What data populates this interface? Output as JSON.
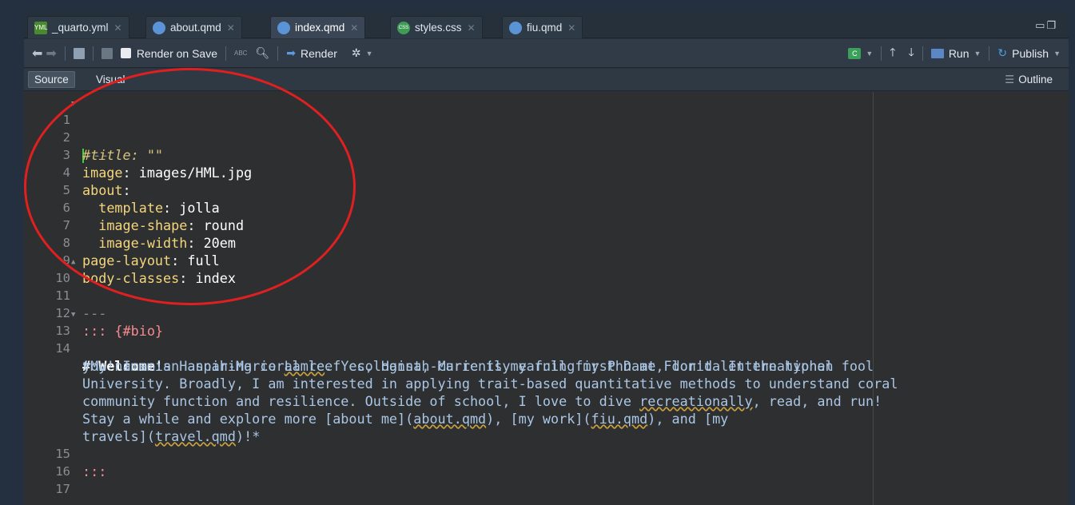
{
  "tabs": [
    {
      "label": "_quarto.yml",
      "icon": "yml-file-icon",
      "icon_text": "YML",
      "active": false
    },
    {
      "label": "about.qmd",
      "icon": "quarto-file-icon",
      "active": false
    },
    {
      "label": "index.qmd",
      "icon": "quarto-file-icon",
      "active": true
    },
    {
      "label": "styles.css",
      "icon": "css-file-icon",
      "icon_text": "CSS",
      "active": false
    },
    {
      "label": "fiu.qmd",
      "icon": "quarto-file-icon",
      "active": false
    }
  ],
  "toolbar": {
    "render_on_save": "Render on Save",
    "render": "Render",
    "run": "Run",
    "publish": "Publish",
    "insert_chunk_text": "C",
    "spell_abc": "ABC"
  },
  "modebar": {
    "source": "Source",
    "visual": "Visual",
    "outline": "Outline"
  },
  "editor": {
    "line_numbers": [
      "1",
      "2",
      "3",
      "4",
      "5",
      "6",
      "7",
      "8",
      "9",
      "10",
      "11",
      "12",
      "13",
      "14",
      "",
      "",
      "",
      "",
      "",
      "15",
      "16",
      "17"
    ],
    "l1": "---",
    "l2": "#title: \"\"",
    "l3_key": "image",
    "l3_val": "images/HML.jpg",
    "l4_key": "about",
    "l5_key": "template",
    "l5_val": "jolla",
    "l6_key": "image-shape",
    "l6_val": "round",
    "l7_key": "image-width",
    "l7_val": "20em",
    "l8_key": "page-layout",
    "l8_val": "full",
    "l9_key": "body-classes",
    "l9_val": "index",
    "l10": "---",
    "l12": "::: {#bio}",
    "l13": "# Welcome!",
    "l14_a1": "*My name is Hannah-Marie ",
    "l14_a2": "Lamle",
    "l14_a3": ". Yes, Hannah-Marie is my full first name, don't let the hyphen fool",
    "l14_b": "you! I am an aspiring coral reef ecologist, currently earning my PhD at Florida International",
    "l14_c": "University. Broadly, I am interested in applying trait-based quantitative methods to understand coral",
    "l14_d1": "community function and resilience. Outside of school, I love to dive ",
    "l14_d2": "recreationally",
    "l14_d3": ", read, and run!",
    "l14_e1": "Stay a while and explore more [about me](",
    "l14_e2": "about.qmd",
    "l14_e3": "), [my work](",
    "l14_e4": "fiu.qmd",
    "l14_e5": "), and [my",
    "l14_f1": "travels](",
    "l14_f2": "travel.qmd",
    "l14_f3": ")!*",
    "l15": ":::"
  },
  "colors": {
    "annotation_ellipse": "#e02020",
    "cursor": "#3bd13b"
  }
}
